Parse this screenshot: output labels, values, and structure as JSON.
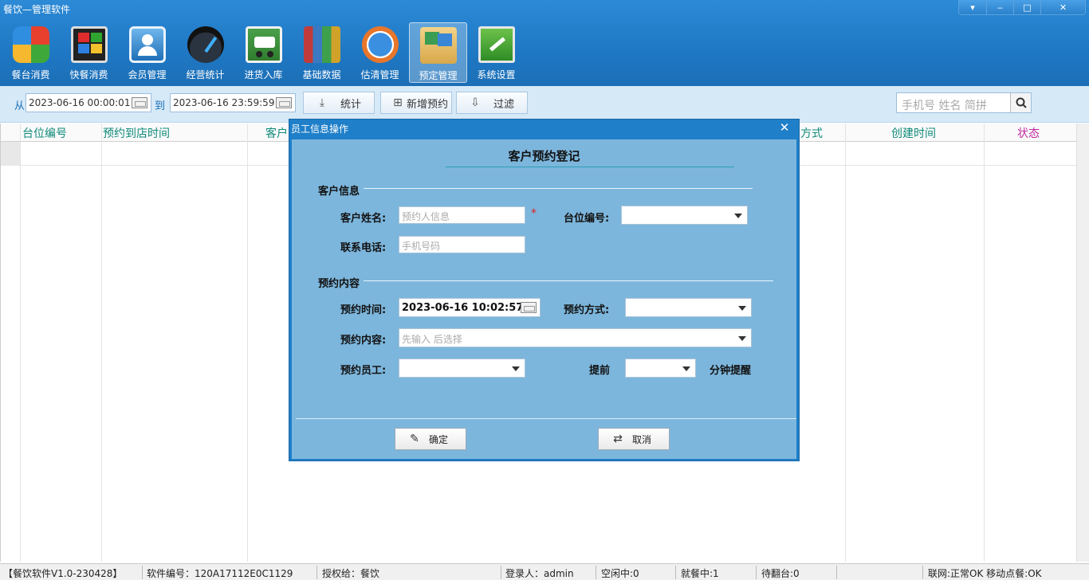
{
  "window": {
    "title": "餐饮—管理软件"
  },
  "nav": {
    "items": [
      {
        "label": "餐台消费",
        "icon": "windows-tiles-icon"
      },
      {
        "label": "快餐消费",
        "icon": "monitor-tiles-icon"
      },
      {
        "label": "会员管理",
        "icon": "members-icon"
      },
      {
        "label": "经营统计",
        "icon": "gauge-icon"
      },
      {
        "label": "进货入库",
        "icon": "delivery-truck-icon"
      },
      {
        "label": "基础数据",
        "icon": "books-icon"
      },
      {
        "label": "估清管理",
        "icon": "refresh-globe-icon"
      },
      {
        "label": "预定管理",
        "icon": "booking-folder-icon"
      },
      {
        "label": "系统设置",
        "icon": "wrench-monitor-icon"
      }
    ],
    "active_index": 7
  },
  "filter": {
    "from_label": "从",
    "from_value": "2023-06-16 00:00:01",
    "to_label": "到",
    "to_value": "2023-06-16 23:59:59",
    "stats_label": "统计",
    "add_label": "新增预约",
    "filter_label": "过滤",
    "search_placeholder": "手机号 姓名 简拼"
  },
  "grid": {
    "columns": [
      "台位编号",
      "预约到店时间",
      "客户",
      "方式",
      "创建时间",
      "状态"
    ]
  },
  "status_bar": {
    "version": "【餐饮软件V1.0-230428】",
    "serial": "软件编号：120A17112E0C1129",
    "licensed": "授权给：餐饮",
    "login": "登录人：admin",
    "idle": "空闲中:0",
    "dining": "就餐中:1",
    "waiting": "待翻台:0",
    "network": "联网:正常OK 移动点餐:OK"
  },
  "dialog": {
    "title": "员工信息操作",
    "heading": "客户预约登记",
    "section_customer": "客户信息",
    "customer_name_label": "客户姓名:",
    "customer_name_placeholder": "预约人信息",
    "required_mark": "*",
    "table_no_label": "台位编号:",
    "phone_label": "联系电话:",
    "phone_placeholder": "手机号码",
    "section_booking": "预约内容",
    "booking_time_label": "预约时间:",
    "booking_time_value": "2023-06-16 10:02:57",
    "booking_method_label": "预约方式:",
    "booking_content_label": "预约内容:",
    "booking_content_placeholder": "先输入 后选择",
    "booking_staff_label": "预约员工:",
    "advance_label": "提前",
    "minutes_reminder_label": "分钟提醒",
    "confirm_label": "确定",
    "cancel_label": "取消"
  }
}
